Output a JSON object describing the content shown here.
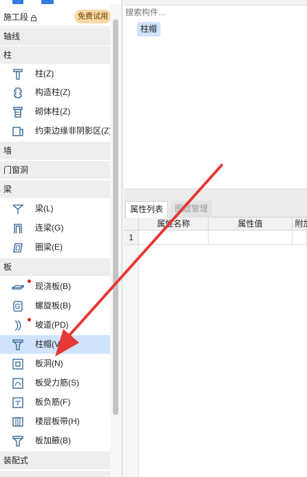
{
  "left_panel": {
    "header": {
      "label": "施工段",
      "badge": "免费试用"
    },
    "categories": {
      "axis": "轴线",
      "column": "柱",
      "wall": "墙",
      "opening": "门窗洞",
      "beam": "梁",
      "slab": "板",
      "prefab": "装配式"
    },
    "column_items": [
      "柱(Z)",
      "构造柱(Z)",
      "砌体柱(Z)",
      "约束边缘非阴影区(Z)"
    ],
    "beam_items": [
      "梁(L)",
      "连梁(G)",
      "圈梁(E)"
    ],
    "slab_items": [
      "现浇板(B)",
      "螺旋板(B)",
      "坡道(PD)",
      "柱帽(V)",
      "板洞(N)",
      "板受力筋(S)",
      "板负筋(F)",
      "楼层板带(H)",
      "板加腋(B)"
    ],
    "selected_item": "柱帽(V)"
  },
  "right_panel": {
    "search": {
      "placeholder": "搜索构件..."
    },
    "components": [
      "柱帽"
    ],
    "tabs": [
      "属性列表",
      "图层管理"
    ],
    "table": {
      "columns": [
        "属性名称",
        "属性值",
        "附加"
      ],
      "row_numbers": [
        "1"
      ]
    }
  },
  "colors": {
    "accent": "#2f7de1",
    "selected_bg": "#cfe3fb",
    "category_bg": "#eeeeee",
    "badge_bg": "#f8d9a5",
    "indicator_dot": "#e0231d",
    "annotation_arrow": "#e53935"
  },
  "icons": {
    "header": "lock-icon",
    "column": "column-t-icon",
    "construct_column": "construct-column-icon",
    "masonry_column": "masonry-column-icon",
    "boundary": "boundary-zone-icon",
    "beam": "beam-icon",
    "link_beam": "link-beam-icon",
    "ring_beam": "ring-beam-icon",
    "cast_slab": "cast-slab-icon",
    "spiral_slab": "spiral-slab-icon",
    "ramp": "ramp-icon",
    "column_cap": "column-cap-icon",
    "slab_opening": "slab-opening-icon",
    "slab_rebar": "slab-rebar-icon",
    "neg_rebar": "negative-rebar-icon",
    "floor_band": "floor-band-icon",
    "haunch": "slab-haunch-icon"
  }
}
